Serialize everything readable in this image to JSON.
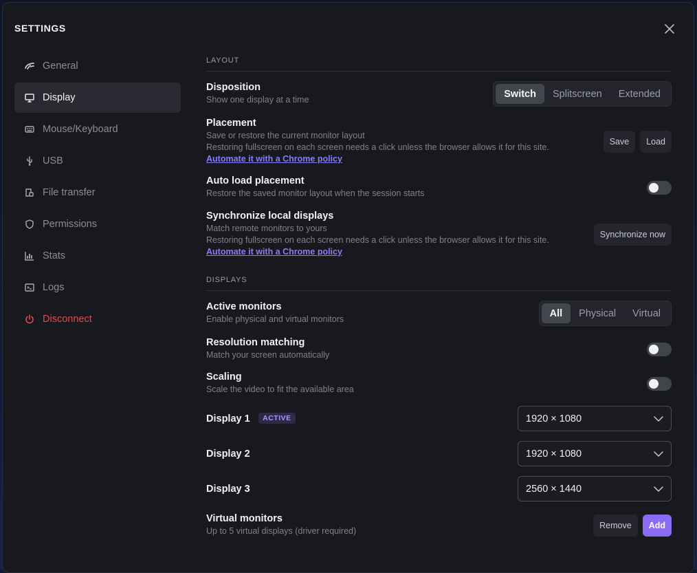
{
  "window": {
    "title": "SETTINGS"
  },
  "sidebar": {
    "items": [
      {
        "label": "General",
        "icon": "gauge-icon"
      },
      {
        "label": "Display",
        "icon": "monitor-icon"
      },
      {
        "label": "Mouse/Keyboard",
        "icon": "keyboard-icon"
      },
      {
        "label": "USB",
        "icon": "usb-icon"
      },
      {
        "label": "File transfer",
        "icon": "file-transfer-icon"
      },
      {
        "label": "Permissions",
        "icon": "shield-icon"
      },
      {
        "label": "Stats",
        "icon": "bar-chart-icon"
      },
      {
        "label": "Logs",
        "icon": "terminal-icon"
      },
      {
        "label": "Disconnect",
        "icon": "power-icon"
      }
    ],
    "active_index": 1
  },
  "layout": {
    "section_title": "LAYOUT",
    "disposition": {
      "label": "Disposition",
      "desc": "Show one display at a time",
      "options": [
        "Switch",
        "Splitscreen",
        "Extended"
      ],
      "selected": "Switch"
    },
    "placement": {
      "label": "Placement",
      "desc1": "Save or restore the current monitor layout",
      "desc2": "Restoring fullscreen on each screen needs a click unless the browser allows it for this site.",
      "link": "Automate it with a Chrome policy",
      "save": "Save",
      "load": "Load"
    },
    "auto_load": {
      "label": "Auto load placement",
      "desc": "Restore the saved monitor layout when the session starts",
      "enabled": false
    },
    "sync": {
      "label": "Synchronize local displays",
      "desc1": "Match remote monitors to yours",
      "desc2": "Restoring fullscreen on each screen needs a click unless the browser allows it for this site.",
      "link": "Automate it with a Chrome policy",
      "button": "Synchronize now"
    }
  },
  "displays": {
    "section_title": "DISPLAYS",
    "active_monitors": {
      "label": "Active monitors",
      "desc": "Enable physical and virtual monitors",
      "options": [
        "All",
        "Physical",
        "Virtual"
      ],
      "selected": "All"
    },
    "resolution_matching": {
      "label": "Resolution matching",
      "desc": "Match your screen automatically",
      "enabled": false
    },
    "scaling": {
      "label": "Scaling",
      "desc": "Scale the video to fit the available area",
      "enabled": false
    },
    "list": [
      {
        "label": "Display 1",
        "badge": "ACTIVE",
        "resolution": "1920 × 1080"
      },
      {
        "label": "Display 2",
        "resolution": "1920 × 1080"
      },
      {
        "label": "Display 3",
        "resolution": "2560 × 1440"
      }
    ],
    "virtual": {
      "label": "Virtual monitors",
      "desc": "Up to 5 virtual displays (driver required)",
      "remove": "Remove",
      "add": "Add"
    }
  },
  "colors": {
    "accent": "#8b6cf4",
    "danger": "#e5484d",
    "link": "#8b7cf6"
  }
}
